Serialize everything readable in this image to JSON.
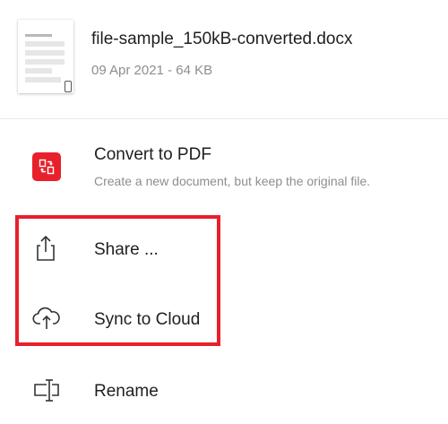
{
  "file": {
    "name": "file-sample_150kB-converted.docx",
    "meta": "09 Apr 2021 - 64 KB"
  },
  "menu": {
    "convert": {
      "label": "Convert to PDF",
      "description": "Create a new document, but keep the original file.",
      "icon": "convert-icon"
    },
    "share": {
      "label": "Share ...",
      "icon": "share-icon"
    },
    "sync": {
      "label": "Sync to Cloud",
      "icon": "cloud-upload-icon"
    },
    "rename": {
      "label": "Rename",
      "icon": "rename-icon"
    }
  },
  "colors": {
    "accent": "#e8202b",
    "text": "#1f1f1f",
    "secondary_text": "#8e8e8e",
    "divider": "#e8e8e8"
  }
}
